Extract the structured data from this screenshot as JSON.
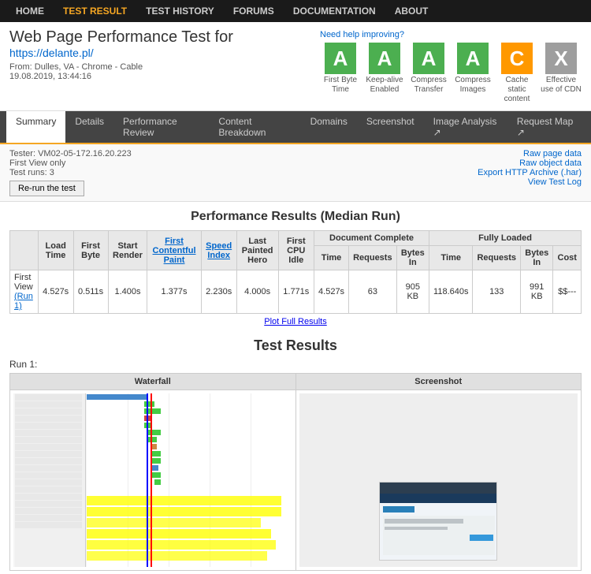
{
  "nav": {
    "items": [
      "HOME",
      "TEST RESULT",
      "TEST HISTORY",
      "FORUMS",
      "DOCUMENTATION",
      "ABOUT"
    ],
    "active": "TEST RESULT"
  },
  "header": {
    "title": "Web Page Performance Test for",
    "url": "https://delante.pl/",
    "from": "From: Dulles, VA - Chrome - Cable",
    "date": "19.08.2019, 13:44:16",
    "help_link": "Need help improving?"
  },
  "grades": [
    {
      "letter": "A",
      "label": "First Byte Time",
      "class": "grade-a"
    },
    {
      "letter": "A",
      "label": "Keep-alive Enabled",
      "class": "grade-a"
    },
    {
      "letter": "A",
      "label": "Compress Transfer",
      "class": "grade-a"
    },
    {
      "letter": "A",
      "label": "Compress Images",
      "class": "grade-a"
    },
    {
      "letter": "C",
      "label": "Cache static content",
      "class": "grade-c"
    },
    {
      "letter": "X",
      "label": "Effective use of CDN",
      "class": "grade-x"
    }
  ],
  "tabs": [
    "Summary",
    "Details",
    "Performance Review",
    "Content Breakdown",
    "Domains",
    "Screenshot",
    "Image Analysis ↗",
    "Request Map ↗"
  ],
  "active_tab": "Summary",
  "info": {
    "tester": "Tester: VM02-05-172.16.20.223",
    "view": "First View only",
    "runs": "Test runs: 3",
    "rerun": "Re-run the test",
    "raw_page": "Raw page data",
    "raw_object": "Raw object data",
    "export": "Export HTTP Archive (.har)",
    "view_log": "View Test Log"
  },
  "performance": {
    "title": "Performance Results (Median Run)",
    "columns": {
      "headers": [
        "Load Time",
        "First Byte",
        "Start Render",
        "First Contentful Paint",
        "Speed Index",
        "Last Painted Hero",
        "First CPU Idle"
      ],
      "doc_complete": [
        "Time",
        "Requests",
        "Bytes In"
      ],
      "fully_loaded": [
        "Time",
        "Requests",
        "Bytes In",
        "Cost"
      ]
    },
    "rows": [
      {
        "name": "First View",
        "run": "Run 1",
        "load_time": "4.527s",
        "first_byte": "0.511s",
        "start_render": "1.400s",
        "first_contentful": "1.377s",
        "speed_index": "2.230s",
        "last_painted": "4.000s",
        "first_cpu": "1.771s",
        "doc_time": "4.527s",
        "doc_requests": "63",
        "doc_bytes": "905 KB",
        "fl_time": "118.640s",
        "fl_requests": "133",
        "fl_bytes": "991 KB",
        "cost": "$$---"
      }
    ],
    "plot_link": "Plot Full Results"
  },
  "test_results": {
    "title": "Test Results",
    "run_label": "Run 1:",
    "waterfall_header": "Waterfall",
    "screenshot_header": "Screenshot"
  }
}
